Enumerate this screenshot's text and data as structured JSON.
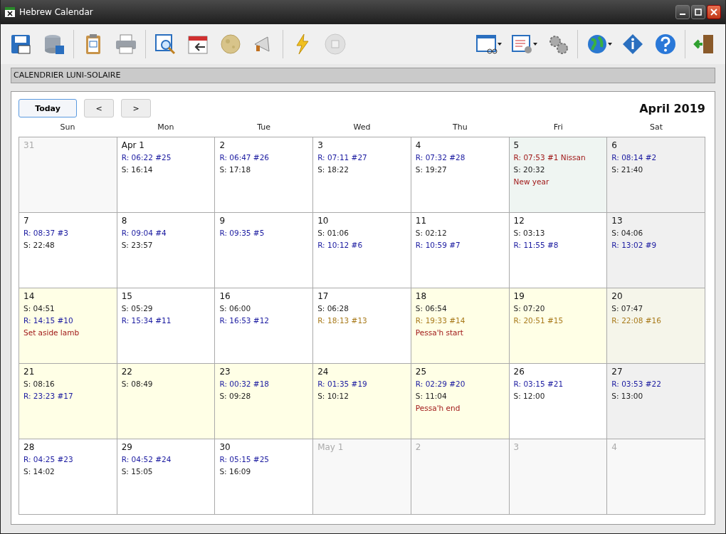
{
  "window": {
    "title": "Hebrew Calendar"
  },
  "banner": "CALENDRIER LUNI-SOLAIRE",
  "nav": {
    "today": "Today",
    "prev": "<",
    "next": ">"
  },
  "month_title": "April 2019",
  "weekdays": [
    "Sun",
    "Mon",
    "Tue",
    "Wed",
    "Thu",
    "Fri",
    "Sat"
  ],
  "weeks": [
    [
      {
        "day": "31",
        "kind": "outside"
      },
      {
        "day": "Apr 1",
        "kind": "plain",
        "lines": [
          {
            "text": "R: 06:22 #25",
            "kind": "rise"
          },
          {
            "text": "S: 16:14",
            "kind": "set"
          }
        ]
      },
      {
        "day": "2",
        "kind": "plain",
        "lines": [
          {
            "text": "R: 06:47 #26",
            "kind": "rise"
          },
          {
            "text": "S: 17:18",
            "kind": "set"
          }
        ]
      },
      {
        "day": "3",
        "kind": "plain",
        "lines": [
          {
            "text": "R: 07:11 #27",
            "kind": "rise"
          },
          {
            "text": "S: 18:22",
            "kind": "set"
          }
        ]
      },
      {
        "day": "4",
        "kind": "plain",
        "lines": [
          {
            "text": "R: 07:32 #28",
            "kind": "rise"
          },
          {
            "text": "S: 19:27",
            "kind": "set"
          }
        ]
      },
      {
        "day": "5",
        "kind": "month-start",
        "lines": [
          {
            "text": "R: 07:53 #1 Nissan",
            "kind": "event"
          },
          {
            "text": "S: 20:32",
            "kind": "set"
          },
          {
            "text": "New year",
            "kind": "event"
          }
        ]
      },
      {
        "day": "6",
        "kind": "sabbath",
        "lines": [
          {
            "text": "R: 08:14 #2",
            "kind": "rise"
          },
          {
            "text": "S: 21:40",
            "kind": "set"
          }
        ]
      }
    ],
    [
      {
        "day": "7",
        "kind": "plain",
        "lines": [
          {
            "text": "R: 08:37 #3",
            "kind": "rise"
          },
          {
            "text": "S: 22:48",
            "kind": "set"
          }
        ]
      },
      {
        "day": "8",
        "kind": "plain",
        "lines": [
          {
            "text": "R: 09:04 #4",
            "kind": "rise"
          },
          {
            "text": "S: 23:57",
            "kind": "set"
          }
        ]
      },
      {
        "day": "9",
        "kind": "plain",
        "lines": [
          {
            "text": "R: 09:35 #5",
            "kind": "rise"
          }
        ]
      },
      {
        "day": "10",
        "kind": "plain",
        "lines": [
          {
            "text": "S: 01:06",
            "kind": "set"
          },
          {
            "text": "R: 10:12 #6",
            "kind": "rise"
          }
        ]
      },
      {
        "day": "11",
        "kind": "plain",
        "lines": [
          {
            "text": "S: 02:12",
            "kind": "set"
          },
          {
            "text": "R: 10:59 #7",
            "kind": "rise"
          }
        ]
      },
      {
        "day": "12",
        "kind": "plain",
        "lines": [
          {
            "text": "S: 03:13",
            "kind": "set"
          },
          {
            "text": "R: 11:55 #8",
            "kind": "rise"
          }
        ]
      },
      {
        "day": "13",
        "kind": "sabbath",
        "lines": [
          {
            "text": "S: 04:06",
            "kind": "set"
          },
          {
            "text": "R: 13:02 #9",
            "kind": "rise"
          }
        ]
      }
    ],
    [
      {
        "day": "14",
        "kind": "holiday",
        "lines": [
          {
            "text": "S: 04:51",
            "kind": "set"
          },
          {
            "text": "R: 14:15 #10",
            "kind": "rise"
          },
          {
            "text": "Set aside lamb",
            "kind": "event"
          }
        ]
      },
      {
        "day": "15",
        "kind": "plain",
        "lines": [
          {
            "text": "S: 05:29",
            "kind": "set"
          },
          {
            "text": "R: 15:34 #11",
            "kind": "rise"
          }
        ]
      },
      {
        "day": "16",
        "kind": "plain",
        "lines": [
          {
            "text": "S: 06:00",
            "kind": "set"
          },
          {
            "text": "R: 16:53 #12",
            "kind": "rise"
          }
        ]
      },
      {
        "day": "17",
        "kind": "plain",
        "lines": [
          {
            "text": "S: 06:28",
            "kind": "set"
          },
          {
            "text": "R: 18:13 #13",
            "kind": "rise-late"
          }
        ]
      },
      {
        "day": "18",
        "kind": "holiday",
        "lines": [
          {
            "text": "S: 06:54",
            "kind": "set"
          },
          {
            "text": "R: 19:33 #14",
            "kind": "rise-late"
          },
          {
            "text": "Pessa'h start",
            "kind": "event"
          }
        ]
      },
      {
        "day": "19",
        "kind": "holiday",
        "lines": [
          {
            "text": "S: 07:20",
            "kind": "set"
          },
          {
            "text": "R: 20:51 #15",
            "kind": "rise-late"
          }
        ]
      },
      {
        "day": "20",
        "kind": "sabbath-holiday",
        "lines": [
          {
            "text": "S: 07:47",
            "kind": "set"
          },
          {
            "text": "R: 22:08 #16",
            "kind": "rise-late"
          }
        ]
      }
    ],
    [
      {
        "day": "21",
        "kind": "holiday",
        "lines": [
          {
            "text": "S: 08:16",
            "kind": "set"
          },
          {
            "text": "R: 23:23 #17",
            "kind": "rise"
          }
        ]
      },
      {
        "day": "22",
        "kind": "holiday",
        "lines": [
          {
            "text": "S: 08:49",
            "kind": "set"
          }
        ]
      },
      {
        "day": "23",
        "kind": "holiday",
        "lines": [
          {
            "text": "R: 00:32 #18",
            "kind": "rise"
          },
          {
            "text": "S: 09:28",
            "kind": "set"
          }
        ]
      },
      {
        "day": "24",
        "kind": "holiday",
        "lines": [
          {
            "text": "R: 01:35 #19",
            "kind": "rise"
          },
          {
            "text": "S: 10:12",
            "kind": "set"
          }
        ]
      },
      {
        "day": "25",
        "kind": "holiday",
        "lines": [
          {
            "text": "R: 02:29 #20",
            "kind": "rise"
          },
          {
            "text": "S: 11:04",
            "kind": "set"
          },
          {
            "text": "Pessa'h end",
            "kind": "event"
          }
        ]
      },
      {
        "day": "26",
        "kind": "plain",
        "lines": [
          {
            "text": "R: 03:15 #21",
            "kind": "rise"
          },
          {
            "text": "S: 12:00",
            "kind": "set"
          }
        ]
      },
      {
        "day": "27",
        "kind": "sabbath",
        "lines": [
          {
            "text": "R: 03:53 #22",
            "kind": "rise"
          },
          {
            "text": "S: 13:00",
            "kind": "set"
          }
        ]
      }
    ],
    [
      {
        "day": "28",
        "kind": "plain",
        "lines": [
          {
            "text": "R: 04:25 #23",
            "kind": "rise"
          },
          {
            "text": "S: 14:02",
            "kind": "set"
          }
        ]
      },
      {
        "day": "29",
        "kind": "plain",
        "lines": [
          {
            "text": "R: 04:52 #24",
            "kind": "rise"
          },
          {
            "text": "S: 15:05",
            "kind": "set"
          }
        ]
      },
      {
        "day": "30",
        "kind": "plain",
        "lines": [
          {
            "text": "R: 05:15 #25",
            "kind": "rise"
          },
          {
            "text": "S: 16:09",
            "kind": "set"
          }
        ]
      },
      {
        "day": "May 1",
        "kind": "outside"
      },
      {
        "day": "2",
        "kind": "outside"
      },
      {
        "day": "3",
        "kind": "outside"
      },
      {
        "day": "4",
        "kind": "outside"
      }
    ]
  ]
}
